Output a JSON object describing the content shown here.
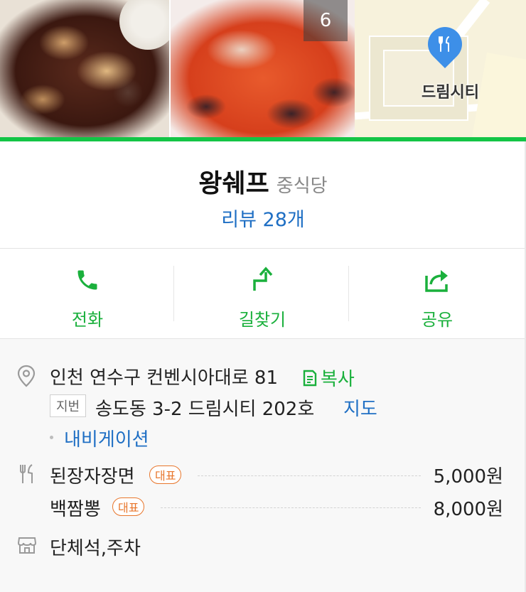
{
  "photos": {
    "count_label": "6",
    "map_label": "드림시티"
  },
  "place": {
    "name": "왕쉐프",
    "category": "중식당",
    "reviews_label": "리뷰 28개"
  },
  "actions": [
    {
      "label": "전화",
      "icon": "phone-icon"
    },
    {
      "label": "길찾기",
      "icon": "directions-icon"
    },
    {
      "label": "공유",
      "icon": "share-icon"
    }
  ],
  "address": {
    "road": "인천 연수구 컨벤시아대로 81",
    "copy_label": "복사",
    "jibeon_tag": "지번",
    "jibeon": "송도동 3-2 드림시티 202호",
    "map_link": "지도",
    "navigation_link": "내비게이션"
  },
  "menu": {
    "items": [
      {
        "name": "된장자장면",
        "badge": "대표",
        "price": "5,000원"
      },
      {
        "name": "백짬뽕",
        "badge": "대표",
        "price": "8,000원"
      }
    ]
  },
  "amenities": {
    "text": "단체석,주차"
  },
  "colors": {
    "accent_green": "#13c546",
    "link_blue": "#1f6fc4",
    "badge_orange": "#e8762c",
    "map_pin_blue": "#3d8fe8"
  }
}
